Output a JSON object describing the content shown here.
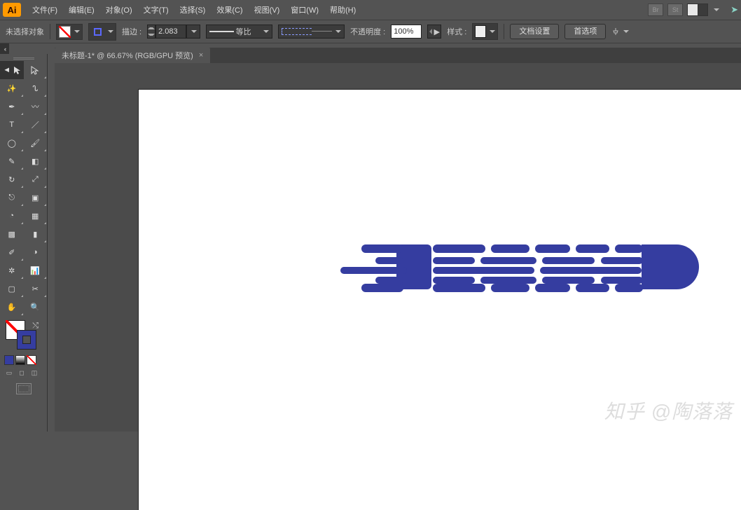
{
  "app": {
    "icon": "Ai"
  },
  "menu": {
    "file": "文件(F)",
    "edit": "编辑(E)",
    "object": "对象(O)",
    "type": "文字(T)",
    "select": "选择(S)",
    "effect": "效果(C)",
    "view": "视图(V)",
    "window": "窗口(W)",
    "help": "帮助(H)",
    "br": "Br",
    "st": "St"
  },
  "opt": {
    "selection": "未选择对象",
    "stroke_label": "描边 :",
    "stroke_width": "2.083",
    "dash_label": "等比",
    "opacity_label": "不透明度 :",
    "opacity_value": "100%",
    "style_label": "样式 :",
    "docsetup": "文档设置",
    "prefs": "首选项"
  },
  "tab": {
    "title": "未标题-1* @ 66.67% (RGB/GPU 预览)"
  },
  "swatches": {
    "c1": "#353da0",
    "c2": "#888888",
    "c3": "#ffffff"
  },
  "watermark": "知乎 @陶落落"
}
